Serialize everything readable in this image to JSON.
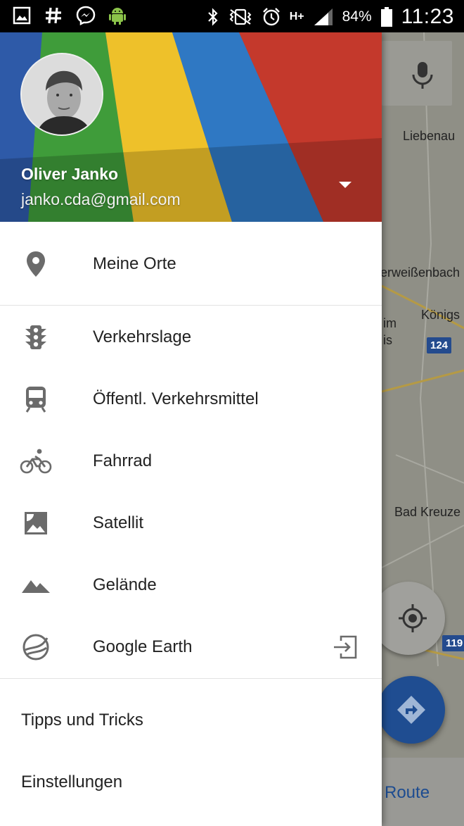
{
  "status_bar": {
    "left_icons": [
      "gallery-icon",
      "hashtag-icon",
      "messenger-icon",
      "android-icon"
    ],
    "right_icons": [
      "bluetooth-icon",
      "vibrate-icon",
      "alarm-icon",
      "network-type-icon",
      "signal-icon",
      "battery-icon"
    ],
    "network_type": "H+",
    "battery_percent": "84%",
    "time": "11:23"
  },
  "account": {
    "name": "Oliver Janko",
    "email": "janko.cda@gmail.com"
  },
  "menu": {
    "my_places": {
      "label": "Meine Orte",
      "icon": "place-pin-icon"
    },
    "layers": [
      {
        "label": "Verkehrslage",
        "icon": "traffic-light-icon"
      },
      {
        "label": "Öffentl. Verkehrsmittel",
        "icon": "transit-train-icon"
      },
      {
        "label": "Fahrrad",
        "icon": "bicycle-icon"
      },
      {
        "label": "Satellit",
        "icon": "satellite-image-icon"
      },
      {
        "label": "Gelände",
        "icon": "terrain-mountains-icon"
      },
      {
        "label": "Google Earth",
        "icon": "google-earth-icon",
        "action_icon": "open-external-icon"
      }
    ],
    "footer": [
      {
        "label": "Tipps und Tricks"
      },
      {
        "label": "Einstellungen"
      }
    ]
  },
  "map": {
    "place_labels": [
      "Liebenau",
      "erweißenbach",
      "Königs",
      "im",
      "is",
      "Bad Kreuze"
    ],
    "road_shields": [
      "124",
      "119"
    ],
    "route_label": "Route",
    "colors": {
      "route_fab": "#1f4d91",
      "drawer_bg": "#ffffff",
      "text": "#222222"
    }
  }
}
